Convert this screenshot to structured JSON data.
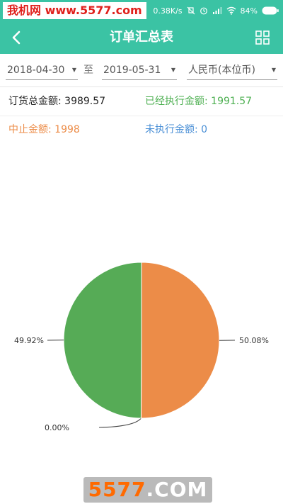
{
  "status_bar": {
    "watermark": "我机网 www.5577.com",
    "speed": "0.38K/s",
    "battery": "84%"
  },
  "header": {
    "title": "订单汇总表",
    "back_icon": "chevron-left-icon",
    "menu_icon": "grid-icon"
  },
  "filters": {
    "start_date": "2018-04-30",
    "separator": "至",
    "end_date": "2019-05-31",
    "currency": "人民币(本位币)"
  },
  "summary": {
    "total_label": "订货总金额:",
    "total_value": "3989.57",
    "executed_label": "已经执行金额:",
    "executed_value": "1991.57",
    "stopped_label": "中止金额:",
    "stopped_value": "1998",
    "unexecuted_label": "未执行金额:",
    "unexecuted_value": "0"
  },
  "colors": {
    "accent": "#3bc3a4",
    "executed": "#4caf50",
    "stopped": "#ec8c48",
    "unexecuted": "#4a8fd6"
  },
  "chart_data": {
    "type": "pie",
    "slices": [
      {
        "label": "50.08%",
        "value": 50.08,
        "color": "#ec8c48"
      },
      {
        "label": "0.00%",
        "value": 0.0,
        "color": "#4a8fd6"
      },
      {
        "label": "49.92%",
        "value": 49.92,
        "color": "#56ab56"
      }
    ]
  },
  "watermark_bottom": {
    "text_hl": "5577",
    "text_rest": ".COM"
  }
}
